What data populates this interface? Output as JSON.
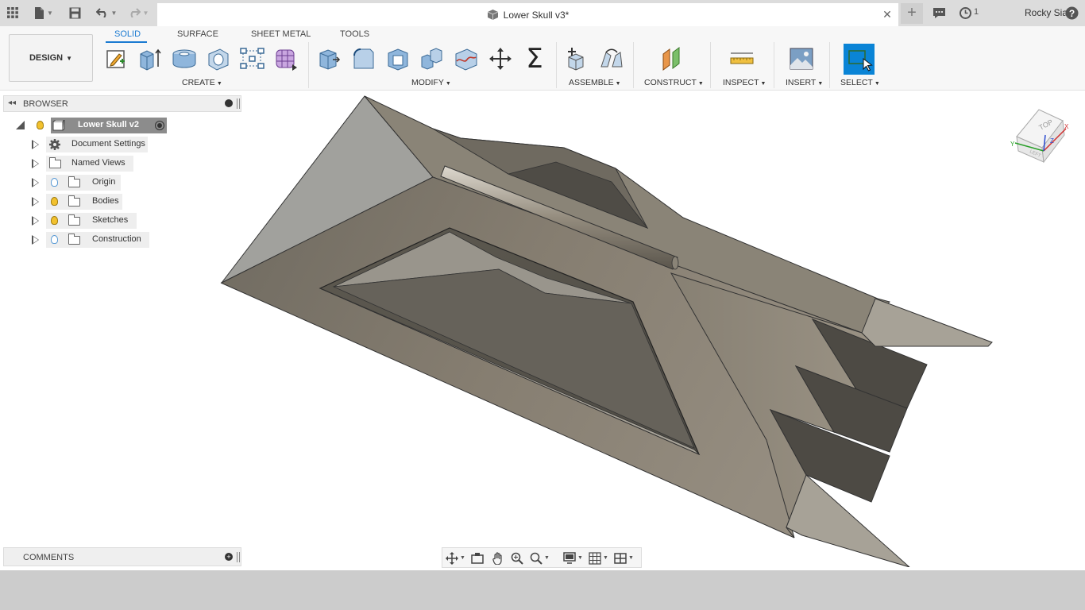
{
  "topbar": {
    "doc_title": "Lower Skull v3*",
    "job_count": "1",
    "user_name": "Rocky Sian",
    "help_label": "?"
  },
  "ribbon": {
    "workspace": "DESIGN",
    "tabs": [
      "SOLID",
      "SURFACE",
      "SHEET METAL",
      "TOOLS"
    ],
    "active_tab": "SOLID",
    "groups": {
      "create": "CREATE",
      "modify": "MODIFY",
      "assemble": "ASSEMBLE",
      "construct": "CONSTRUCT",
      "inspect": "INSPECT",
      "insert": "INSERT",
      "select": "SELECT"
    },
    "sigma_glyph": "Σ"
  },
  "browser": {
    "title": "BROWSER",
    "root": "Lower Skull v2",
    "items": [
      {
        "label": "Document Settings",
        "icon": "gear-icon"
      },
      {
        "label": "Named Views",
        "icon": "folder-icon"
      },
      {
        "label": "Origin",
        "icon": "folder-icon",
        "bulb": "blue"
      },
      {
        "label": "Bodies",
        "icon": "folder-icon",
        "bulb": "yellow"
      },
      {
        "label": "Sketches",
        "icon": "folder-icon",
        "bulb": "yellow"
      },
      {
        "label": "Construction",
        "icon": "folder-icon",
        "bulb": "blue"
      }
    ]
  },
  "comments": {
    "title": "COMMENTS"
  },
  "viewcube": {
    "top": "TOP",
    "left": "LEFT",
    "x": "X",
    "y": "Y",
    "z": "Z"
  },
  "colors": {
    "accent": "#1a7ad1",
    "select_blue": "#0a84d6",
    "bulb_yellow": "#f2c12e",
    "bulb_blue": "#5b9bd5",
    "model_face": "#8f877a"
  }
}
